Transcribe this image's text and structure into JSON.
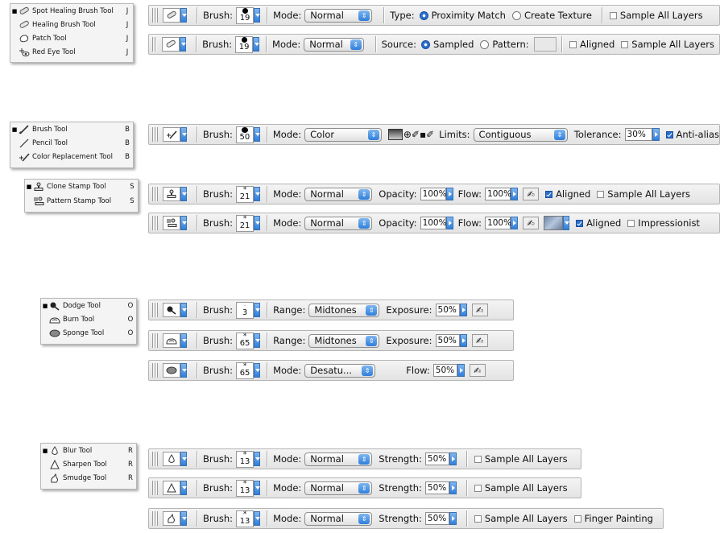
{
  "menus": {
    "healing": {
      "items": [
        {
          "label": "Spot Healing Brush Tool",
          "key": "J",
          "icon": "spot-healing-brush-icon",
          "selected": true
        },
        {
          "label": "Healing Brush Tool",
          "key": "J",
          "icon": "healing-brush-icon",
          "selected": false
        },
        {
          "label": "Patch Tool",
          "key": "J",
          "icon": "patch-icon",
          "selected": false
        },
        {
          "label": "Red Eye Tool",
          "key": "J",
          "icon": "red-eye-icon",
          "selected": false
        }
      ]
    },
    "brush": {
      "items": [
        {
          "label": "Brush Tool",
          "key": "B",
          "icon": "brush-icon",
          "selected": true
        },
        {
          "label": "Pencil Tool",
          "key": "B",
          "icon": "pencil-icon",
          "selected": false
        },
        {
          "label": "Color Replacement Tool",
          "key": "B",
          "icon": "color-replacement-icon",
          "selected": false
        }
      ]
    },
    "stamp": {
      "items": [
        {
          "label": "Clone Stamp Tool",
          "key": "S",
          "icon": "clone-stamp-icon",
          "selected": true
        },
        {
          "label": "Pattern Stamp Tool",
          "key": "S",
          "icon": "pattern-stamp-icon",
          "selected": false
        }
      ]
    },
    "toning": {
      "items": [
        {
          "label": "Dodge Tool",
          "key": "O",
          "icon": "dodge-icon",
          "selected": true
        },
        {
          "label": "Burn Tool",
          "key": "O",
          "icon": "burn-icon",
          "selected": false
        },
        {
          "label": "Sponge Tool",
          "key": "O",
          "icon": "sponge-icon",
          "selected": false
        }
      ]
    },
    "focus": {
      "items": [
        {
          "label": "Blur Tool",
          "key": "R",
          "icon": "blur-icon",
          "selected": true
        },
        {
          "label": "Sharpen Tool",
          "key": "R",
          "icon": "sharpen-icon",
          "selected": false
        },
        {
          "label": "Smudge Tool",
          "key": "R",
          "icon": "smudge-icon",
          "selected": false
        }
      ]
    }
  },
  "labels": {
    "brush": "Brush:",
    "mode": "Mode:",
    "type": "Type:",
    "source": "Source:",
    "pattern": "Pattern:",
    "limits": "Limits:",
    "tolerance": "Tolerance:",
    "opacity": "Opacity:",
    "flow": "Flow:",
    "range": "Range:",
    "exposure": "Exposure:",
    "strength": "Strength:"
  },
  "bars": {
    "spot_healing": {
      "brush_size": "19",
      "mode": "Normal",
      "proximity": "Proximity Match",
      "create_texture": "Create Texture",
      "sample_all_layers": "Sample All Layers"
    },
    "healing": {
      "brush_size": "19",
      "mode": "Normal",
      "sampled": "Sampled",
      "aligned": "Aligned",
      "sample_all_layers": "Sample All Layers"
    },
    "brush": {
      "brush_size": "50",
      "mode": "Color",
      "limits": "Contiguous",
      "tolerance": "30%",
      "anti_alias": "Anti-alias"
    },
    "clone_stamp": {
      "brush_size": "21",
      "mode": "Normal",
      "opacity": "100%",
      "flow": "100%",
      "aligned": "Aligned",
      "sample_all_layers": "Sample All Layers"
    },
    "pattern_stamp": {
      "brush_size": "21",
      "mode": "Normal",
      "opacity": "100%",
      "flow": "100%",
      "aligned": "Aligned",
      "impressionist": "Impressionist"
    },
    "dodge": {
      "brush_size": "3",
      "range": "Midtones",
      "exposure": "50%"
    },
    "burn": {
      "brush_size": "65",
      "range": "Midtones",
      "exposure": "50%"
    },
    "sponge": {
      "brush_size": "65",
      "mode": "Desatu...",
      "flow": "50%"
    },
    "blur": {
      "brush_size": "13",
      "mode": "Normal",
      "strength": "50%",
      "sample_all_layers": "Sample All Layers"
    },
    "sharpen": {
      "brush_size": "13",
      "mode": "Normal",
      "strength": "50%",
      "sample_all_layers": "Sample All Layers"
    },
    "smudge": {
      "brush_size": "13",
      "mode": "Normal",
      "strength": "50%",
      "sample_all_layers": "Sample All Layers",
      "finger_painting": "Finger Painting"
    }
  },
  "colors": {
    "accent": "#2f7fdc",
    "bar_bg": "#ececec"
  }
}
